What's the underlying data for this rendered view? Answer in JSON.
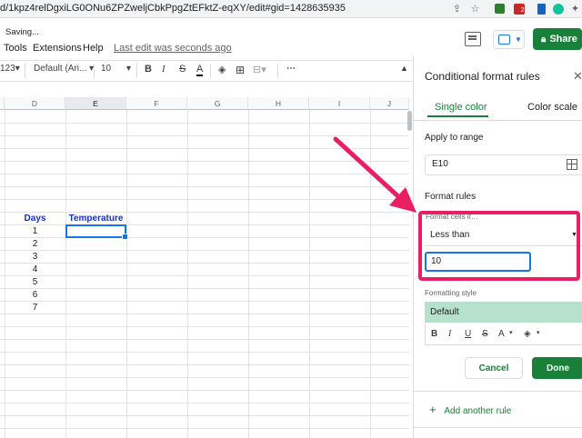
{
  "browser": {
    "url": "d/1kpz4relDgxiLG0ONu6ZPZweljCbkPpgZtEFktZ-eqXY/edit#gid=1428635935",
    "ext_badge_count": "2"
  },
  "header": {
    "status": "Saving...",
    "menus": [
      "Tools",
      "Extensions",
      "Help"
    ],
    "last_edit": "Last edit was seconds ago",
    "share_label": "Share"
  },
  "toolbar": {
    "format_123": "123",
    "font": "Default (Ari...",
    "font_size": "10",
    "bold": "B",
    "italic": "I",
    "strike": "S",
    "text_color": "A"
  },
  "grid": {
    "columns": [
      "D",
      "E",
      "F",
      "G",
      "H",
      "I",
      "J"
    ],
    "selected_column": "E",
    "days_header": "Days",
    "temperature_header": "Temperature",
    "days": [
      "1",
      "2",
      "3",
      "4",
      "5",
      "6",
      "7"
    ]
  },
  "panel": {
    "title": "Conditional format rules",
    "tabs": [
      "Single color",
      "Color scale"
    ],
    "apply_label": "Apply to range",
    "range": "E10",
    "rules_label": "Format rules",
    "condition_label": "Format cells if…",
    "condition": "Less than",
    "value": "10",
    "style_label": "Formatting style",
    "style_preview": "Default",
    "style_tools": {
      "bold": "B",
      "italic": "I",
      "underline": "U",
      "strike": "S",
      "text_color": "A"
    },
    "cancel_label": "Cancel",
    "done_label": "Done",
    "add_rule": "Add another rule"
  },
  "colors": {
    "accent_green": "#188038",
    "annotation_arrow": "#e91e63",
    "selection_blue": "#1a73e8",
    "style_preview_bg": "#b7e1cd"
  }
}
